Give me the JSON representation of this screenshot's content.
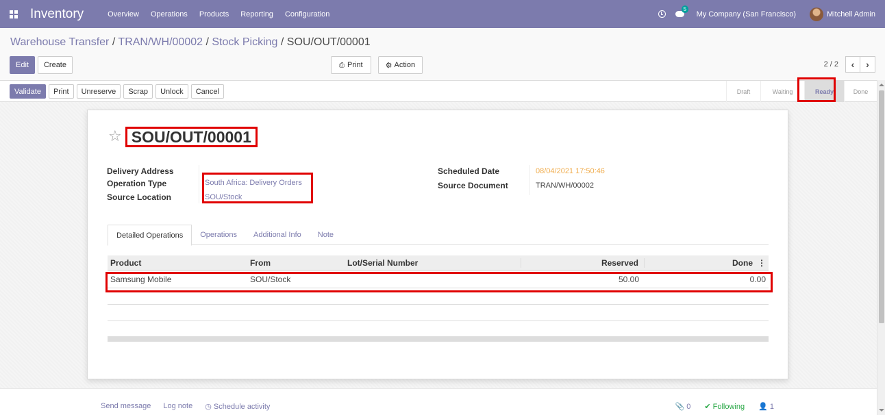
{
  "nav": {
    "app_name": "Inventory",
    "menu": [
      "Overview",
      "Operations",
      "Products",
      "Reporting",
      "Configuration"
    ],
    "chat_count": "5",
    "company": "My Company (San Francisco)",
    "user": "Mitchell Admin"
  },
  "breadcrumb": {
    "items": [
      "Warehouse Transfer",
      "TRAN/WH/00002",
      "Stock Picking"
    ],
    "current": "SOU/OUT/00001",
    "separator": "/"
  },
  "control": {
    "edit": "Edit",
    "create": "Create",
    "print": "Print",
    "action": "Action",
    "pager": "2 / 2"
  },
  "statusbar": {
    "buttons": [
      "Validate",
      "Print",
      "Unreserve",
      "Scrap",
      "Unlock",
      "Cancel"
    ],
    "stages": [
      "Draft",
      "Waiting",
      "Ready",
      "Done"
    ],
    "active_stage": "Ready"
  },
  "record": {
    "name": "SOU/OUT/00001",
    "labels": {
      "delivery_address": "Delivery Address",
      "operation_type": "Operation Type",
      "source_location": "Source Location",
      "scheduled_date": "Scheduled Date",
      "source_document": "Source Document"
    },
    "operation_type": "South Africa: Delivery Orders",
    "source_location": "SOU/Stock",
    "scheduled_date": "08/04/2021 17:50:46",
    "source_document": "TRAN/WH/00002"
  },
  "tabs": [
    "Detailed Operations",
    "Operations",
    "Additional Info",
    "Note"
  ],
  "table": {
    "headers": [
      "Product",
      "From",
      "Lot/Serial Number",
      "Reserved",
      "Done"
    ],
    "rows": [
      {
        "product": "Samsung Mobile",
        "from": "SOU/Stock",
        "lot": "",
        "reserved": "50.00",
        "done": "0.00"
      }
    ]
  },
  "chatter": {
    "send_message": "Send message",
    "log_note": "Log note",
    "schedule_activity": "Schedule activity",
    "attachments": "0",
    "following": "Following",
    "followers": "1"
  }
}
